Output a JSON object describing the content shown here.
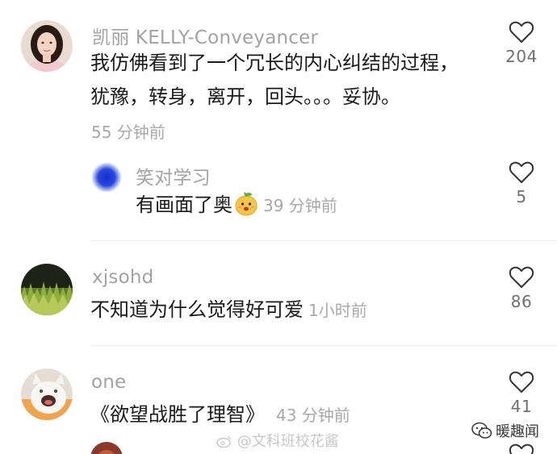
{
  "comments": [
    {
      "username": "凯丽 KELLY-Conveyancer",
      "text_line1": "我仿佛看到了一个冗长的内心纠结的过程，",
      "text_line2": "犹豫，转身，离开，回头。。。妥协。",
      "time": "55 分钟前",
      "likes": "204",
      "avatar": "woman-portrait"
    },
    {
      "username": "笑对学习",
      "text": "有画面了奥",
      "time": "39 分钟前",
      "likes": "5",
      "avatar": "blue-dot",
      "emoji": "mango-face-emoji"
    },
    {
      "username": "xjsohd",
      "text": "不知道为什么觉得好可爱",
      "time": "1小时前",
      "likes": "86",
      "avatar": "grass-field"
    },
    {
      "username": "one",
      "text": "《欲望战胜了理智》",
      "time": "43 分钟前",
      "likes": "41",
      "avatar": "white-cat"
    }
  ],
  "watermark": "@文科班校花酱",
  "brand": "暖趣闻",
  "colors": {
    "text": "#1a1a1a",
    "meta": "#a2a2a2",
    "divider": "#ececec"
  }
}
